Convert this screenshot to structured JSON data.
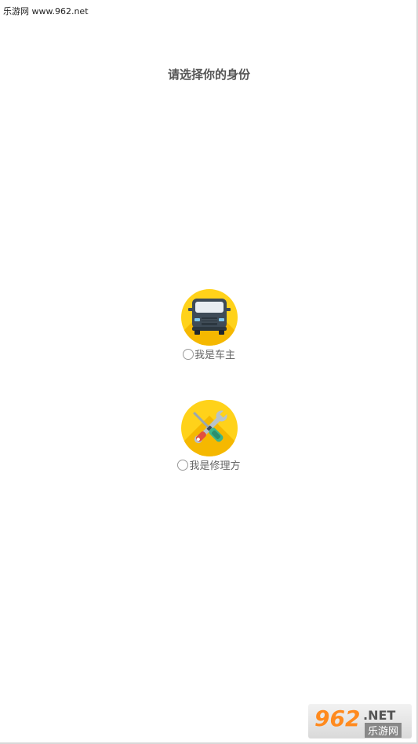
{
  "watermark_top": "乐游网 www.962.net",
  "title": "请选择你的身份",
  "options": [
    {
      "label": "我是车主",
      "icon": "car-icon",
      "selected": false
    },
    {
      "label": "我是修理方",
      "icon": "tools-icon",
      "selected": false
    }
  ],
  "watermark_bottom": {
    "number": "962",
    "suffix": ".NET",
    "brand": "乐游网"
  },
  "colors": {
    "icon_bg": "#ffd21a",
    "icon_shadow": "#f5b800",
    "title": "#555555",
    "label": "#666666"
  }
}
